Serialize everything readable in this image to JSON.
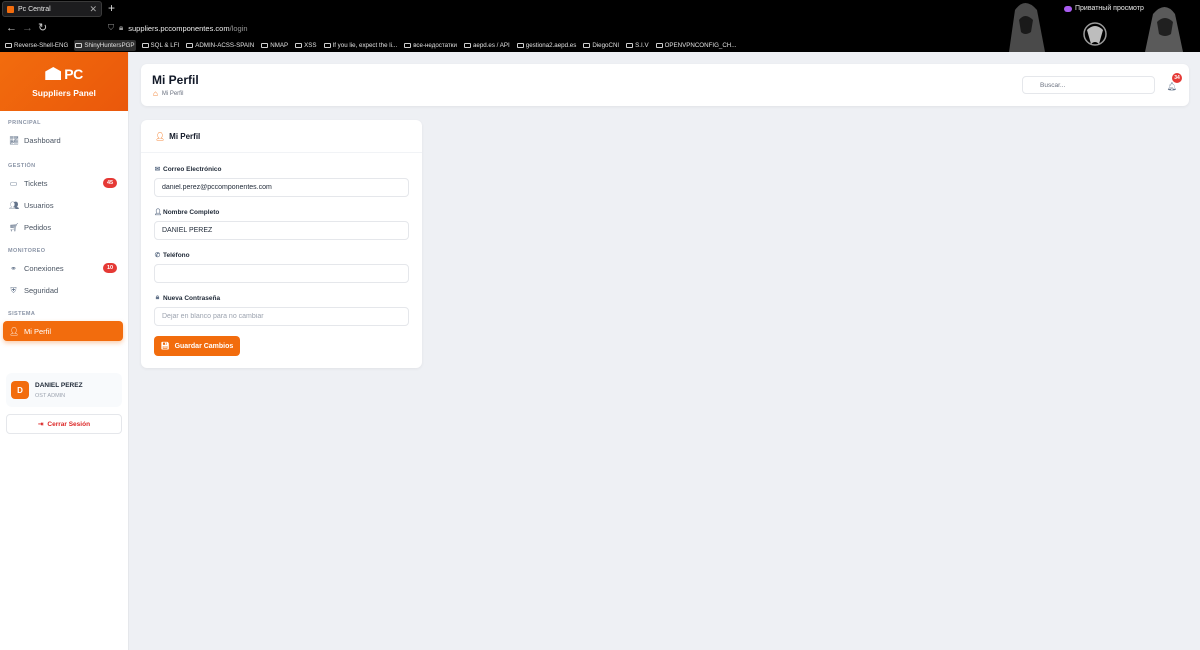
{
  "browser": {
    "tab_title": "Pc Central",
    "tab_close": "✕",
    "new_tab": "+",
    "private_label": "Приватный просмотр",
    "url_host": "suppliers.pccomponentes.com",
    "url_path": "/login",
    "bookmarks": [
      "Reverse-Shell-ENG",
      "ShinyHuntersPGP",
      "SQL & LFI",
      "ADMIN-ACSS-SPAIN",
      "NMAP",
      "XSS",
      "If you lie, expect the li...",
      "все-недостатки",
      "aepd.es / API",
      "gestiona2.aepd.es",
      "DiegoCNI",
      "S.I.V",
      "OPENVPNCONFIG_CH..."
    ]
  },
  "brand": {
    "logo_text": "PC",
    "panel_title": "Suppliers Panel"
  },
  "sidebar": {
    "sections": {
      "principal": "PRINCIPAL",
      "gestion": "GESTIÓN",
      "monitoreo": "MONITOREO",
      "sistema": "SISTEMA"
    },
    "items": {
      "dashboard": {
        "label": "Dashboard",
        "icon": "chart-line-icon"
      },
      "tickets": {
        "label": "Tickets",
        "icon": "ticket-icon",
        "badge": "45"
      },
      "usuarios": {
        "label": "Usuarios",
        "icon": "users-icon"
      },
      "pedidos": {
        "label": "Pedidos",
        "icon": "cart-icon"
      },
      "conexiones": {
        "label": "Conexiones",
        "icon": "network-icon",
        "badge": "10"
      },
      "seguridad": {
        "label": "Seguridad",
        "icon": "shield-icon"
      },
      "mi_perfil": {
        "label": "Mi Perfil",
        "icon": "user-cog-icon"
      }
    },
    "user": {
      "initial": "D",
      "name": "DANIEL PEREZ",
      "role": "OST ADMIN"
    },
    "logout_label": "Cerrar Sesión"
  },
  "header": {
    "title": "Mi Perfil",
    "breadcrumb": "Mi Perfil",
    "search_placeholder": "Buscar...",
    "notifications": "34"
  },
  "profile": {
    "card_title": "Mi Perfil",
    "email_label": "Correo Electrónico",
    "email_value": "daniel.perez@pccomponentes.com",
    "name_label": "Nombre Completo",
    "name_value": "DANIEL PEREZ",
    "phone_label": "Teléfono",
    "phone_value": "",
    "password_label": "Nueva Contraseña",
    "password_placeholder": "Dejar en blanco para no cambiar",
    "save_label": "Guardar Cambios"
  },
  "colors": {
    "accent": "#f26c0d",
    "badge": "#e53935",
    "logout": "#dc2626"
  }
}
